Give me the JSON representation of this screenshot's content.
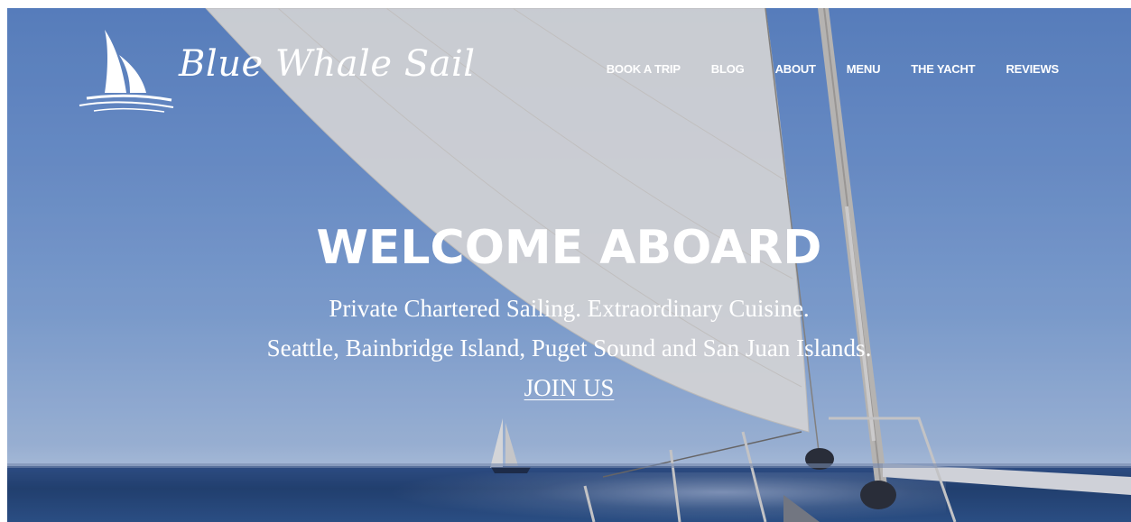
{
  "brand": {
    "name": "Blue Whale Sail"
  },
  "nav": {
    "items": [
      {
        "label": "BOOK A TRIP"
      },
      {
        "label": "BLOG"
      },
      {
        "label": "ABOUT"
      },
      {
        "label": "MENU"
      },
      {
        "label": "THE YACHT"
      },
      {
        "label": "REVIEWS"
      }
    ]
  },
  "hero": {
    "headline": "WELCOME ABOARD",
    "tagline_line1": "Private Chartered Sailing. Extraordinary Cuisine.",
    "tagline_line2": "Seattle, Bainbridge Island, Puget Sound and San Juan Islands.",
    "cta_label": "JOIN US"
  },
  "icons": {
    "logo": "sailboat-logo-icon"
  },
  "colors": {
    "sky": "#6f95cf",
    "sea": "#21406f",
    "text": "#ffffff",
    "sail": "#e8e6e2"
  }
}
